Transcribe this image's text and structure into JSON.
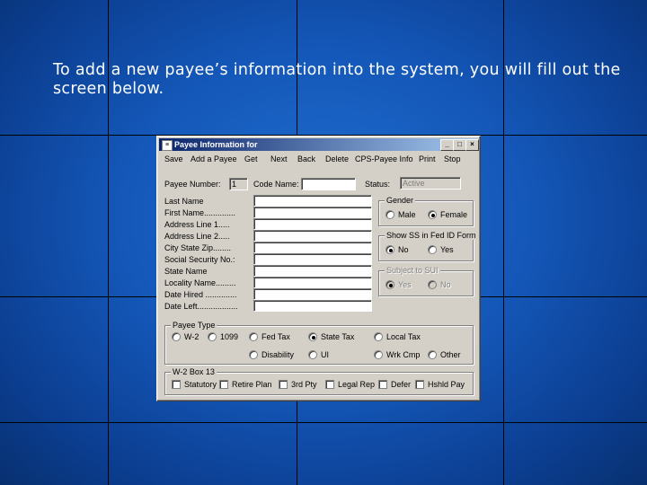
{
  "slide": {
    "caption": "To add a new payee’s information into the system, you will fill out the screen below."
  },
  "window": {
    "title": "Payee Information for",
    "icon_glyph": "≡",
    "min_glyph": "_",
    "max_glyph": "□",
    "close_glyph": "×",
    "menu": [
      "Save",
      "Add a Payee",
      "Get",
      "Next",
      "Back",
      "Delete",
      "CPS-Payee Info",
      "Print",
      "Stop"
    ],
    "payee_number_label": "Payee Number:",
    "payee_number_value": "1",
    "code_name_label": "Code Name:",
    "code_name_value": "",
    "status_label": "Status:",
    "status_value": "Active",
    "fields": [
      {
        "label": "Last Name",
        "value": ""
      },
      {
        "label": "First Name..............",
        "value": ""
      },
      {
        "label": "Address Line 1.....",
        "value": ""
      },
      {
        "label": "Address Line 2.....",
        "value": ""
      },
      {
        "label": "City State Zip........",
        "value": ""
      },
      {
        "label": "Social Security No.:",
        "value": ""
      },
      {
        "label": "State Name",
        "value": ""
      },
      {
        "label": "Locality Name.........",
        "value": ""
      },
      {
        "label": "Date Hired ..............",
        "value": ""
      },
      {
        "label": "Date Left..................",
        "value": ""
      }
    ],
    "gender": {
      "title": "Gender",
      "options": [
        "Male",
        "Female"
      ],
      "selected": "Female"
    },
    "show_ss": {
      "title": "Show SS in Fed ID Form",
      "options": [
        "No",
        "Yes"
      ],
      "selected": "No"
    },
    "subject_sui": {
      "title": "Subject to SUI",
      "options": [
        "Yes",
        "No"
      ],
      "selected": "Yes"
    },
    "payee_type": {
      "title": "Payee Type",
      "row1": [
        "W-2",
        "1099",
        "Fed Tax",
        "State Tax",
        "Local Tax"
      ],
      "row2": [
        "Disability",
        "UI",
        "Wrk Cmp",
        "Other"
      ],
      "selected": "State Tax"
    },
    "w2_box": {
      "title": "W-2 Box 13",
      "options": [
        "Statutory",
        "Retire Plan",
        "3rd Pty",
        "Legal Rep",
        "Defer",
        "Hshld Pay"
      ]
    }
  }
}
